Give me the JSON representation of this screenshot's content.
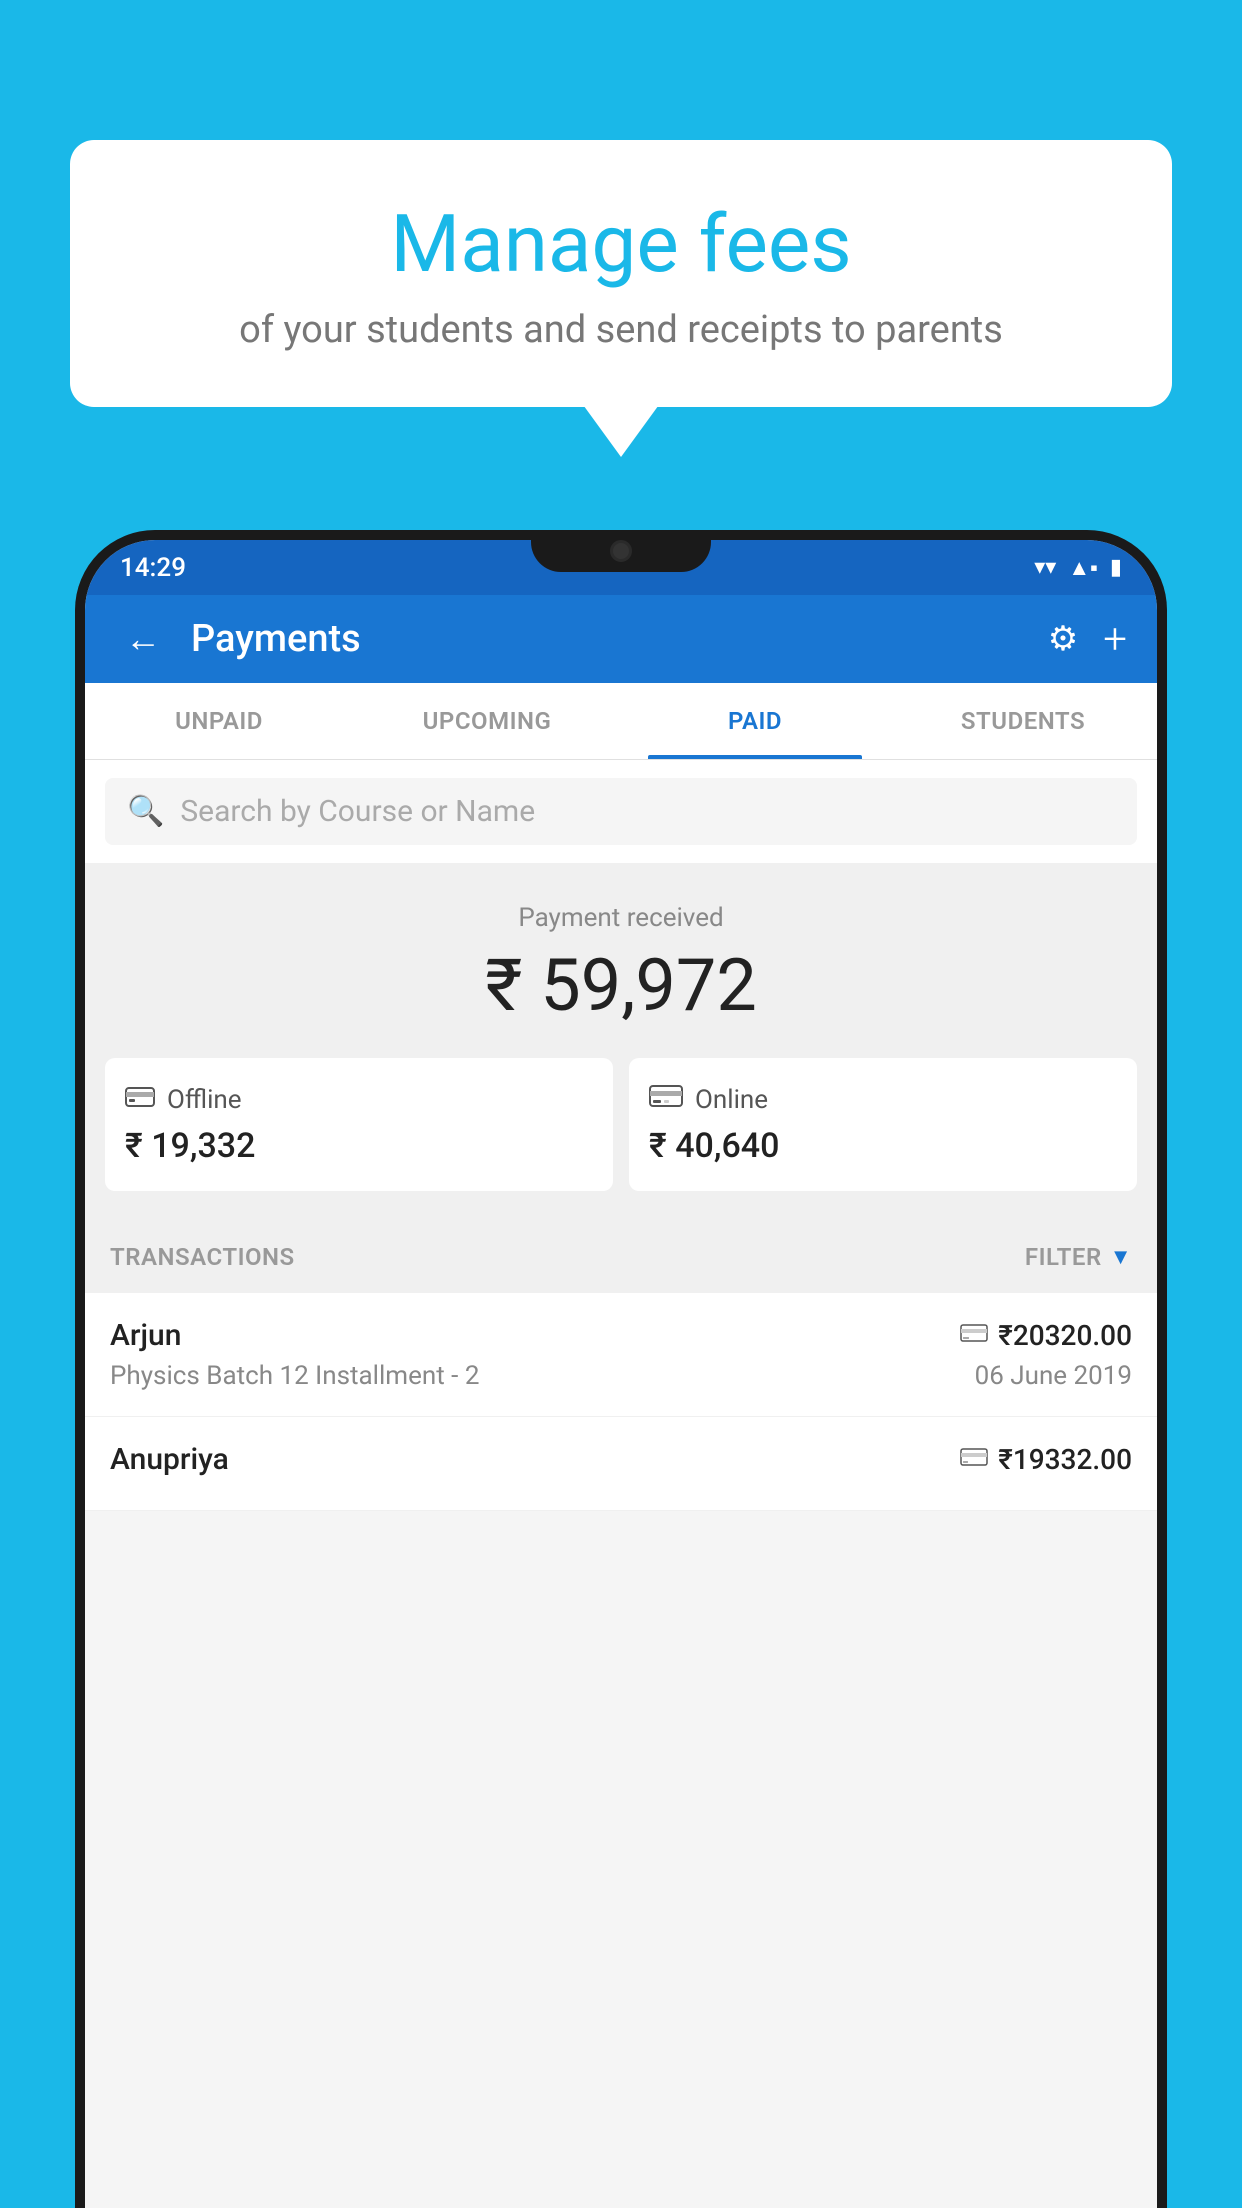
{
  "background_color": "#1ab8e8",
  "bubble": {
    "title": "Manage fees",
    "subtitle": "of your students and send receipts to parents"
  },
  "status_bar": {
    "time": "14:29",
    "wifi": "▼",
    "signal": "▲",
    "battery": "▮"
  },
  "app_bar": {
    "title": "Payments",
    "back_label": "←",
    "settings_label": "⚙",
    "add_label": "+"
  },
  "tabs": [
    {
      "label": "UNPAID",
      "active": false
    },
    {
      "label": "UPCOMING",
      "active": false
    },
    {
      "label": "PAID",
      "active": true
    },
    {
      "label": "STUDENTS",
      "active": false
    }
  ],
  "search": {
    "placeholder": "Search by Course or Name"
  },
  "payment_summary": {
    "label": "Payment received",
    "total": "₹ 59,972",
    "offline": {
      "type": "Offline",
      "amount": "₹ 19,332"
    },
    "online": {
      "type": "Online",
      "amount": "₹ 40,640"
    }
  },
  "transactions_header": {
    "label": "TRANSACTIONS",
    "filter": "FILTER"
  },
  "transactions": [
    {
      "name": "Arjun",
      "course": "Physics Batch 12 Installment - 2",
      "amount": "₹20320.00",
      "date": "06 June 2019",
      "payment_type": "card"
    },
    {
      "name": "Anupriya",
      "course": "",
      "amount": "₹19332.00",
      "date": "",
      "payment_type": "cash"
    }
  ]
}
